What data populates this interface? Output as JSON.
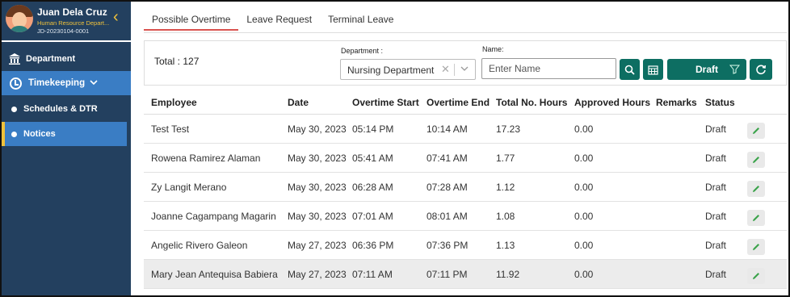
{
  "user": {
    "name": "Juan Dela Cruz",
    "department": "Human Resource Depart...",
    "id": "JD-20230104-0001"
  },
  "sidebar": {
    "collapse_icon": "chevron-left-icon",
    "items": [
      {
        "label": "Department",
        "icon": "building-icon"
      },
      {
        "label": "Timekeeping",
        "icon": "clock-icon"
      },
      {
        "label": "Schedules & DTR"
      },
      {
        "label": "Notices"
      }
    ]
  },
  "tabs": [
    {
      "label": "Possible Overtime",
      "active": true
    },
    {
      "label": "Leave Request"
    },
    {
      "label": "Terminal Leave"
    }
  ],
  "filters": {
    "total": "Total : 127",
    "department_label": "Department :",
    "department_value": "Nursing Department",
    "name_label": "Name:",
    "name_placeholder": "Enter Name",
    "status_button": "Draft"
  },
  "colors": {
    "sidebar": "#23405f",
    "sidebar_active": "#3a7dc4",
    "accent_yellow": "#f0c23b",
    "teal_button": "#0d6e62",
    "edit_icon": "#3aa34a"
  },
  "table": {
    "headers": [
      "Employee",
      "Date",
      "Overtime Start",
      "Overtime End",
      "Total No. Hours",
      "Approved Hours",
      "Remarks",
      "Status"
    ],
    "rows": [
      {
        "employee": "Test Test",
        "date": "May 30, 2023",
        "start": "05:14 PM",
        "end": "10:14 AM",
        "total": "17.23",
        "approved": "0.00",
        "remarks": "",
        "status": "Draft"
      },
      {
        "employee": "Rowena Ramirez Alaman",
        "date": "May 30, 2023",
        "start": "05:41 AM",
        "end": "07:41 AM",
        "total": "1.77",
        "approved": "0.00",
        "remarks": "",
        "status": "Draft"
      },
      {
        "employee": "Zy Langit Merano",
        "date": "May 30, 2023",
        "start": "06:28 AM",
        "end": "07:28 AM",
        "total": "1.12",
        "approved": "0.00",
        "remarks": "",
        "status": "Draft"
      },
      {
        "employee": "Joanne Cagampang Magarin",
        "date": "May 30, 2023",
        "start": "07:01 AM",
        "end": "08:01 AM",
        "total": "1.08",
        "approved": "0.00",
        "remarks": "",
        "status": "Draft"
      },
      {
        "employee": "Angelic Rivero Galeon",
        "date": "May 27, 2023",
        "start": "06:36 PM",
        "end": "07:36 PM",
        "total": "1.13",
        "approved": "0.00",
        "remarks": "",
        "status": "Draft"
      },
      {
        "employee": "Mary Jean Antequisa Babiera",
        "date": "May 27, 2023",
        "start": "07:11 AM",
        "end": "07:11 PM",
        "total": "11.92",
        "approved": "0.00",
        "remarks": "",
        "status": "Draft"
      }
    ]
  }
}
